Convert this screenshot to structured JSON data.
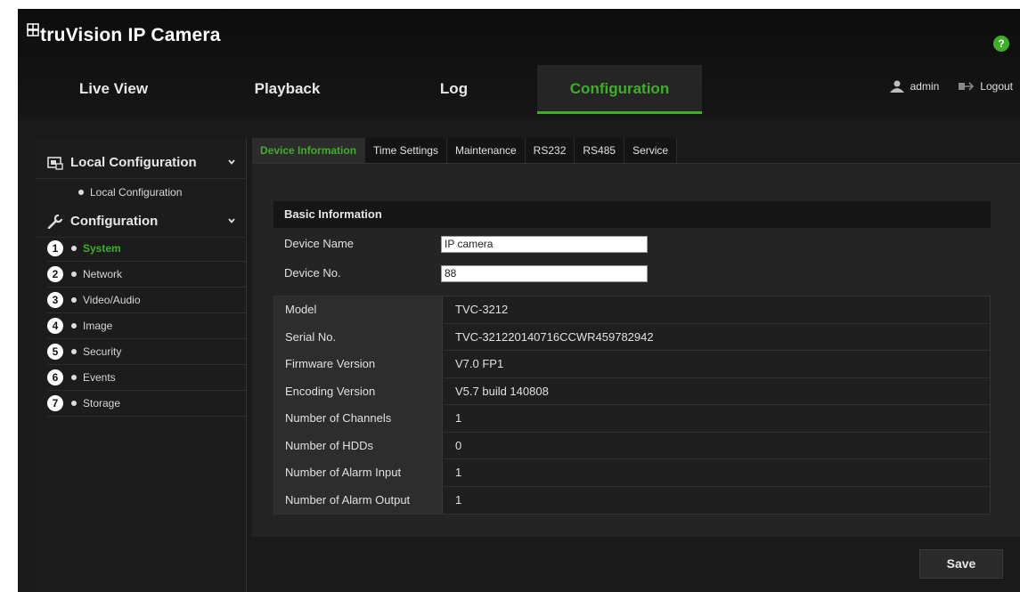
{
  "app": {
    "brand": "truVision IP Camera",
    "help": "?"
  },
  "nav": {
    "tabs": [
      "Live View",
      "Playback",
      "Log",
      "Configuration"
    ],
    "active": "Configuration"
  },
  "user": {
    "name": "admin",
    "logout": "Logout"
  },
  "sidebar": {
    "local_group": "Local Configuration",
    "local_item": "Local Configuration",
    "config_group": "Configuration",
    "items": [
      {
        "num": "1",
        "label": "System"
      },
      {
        "num": "2",
        "label": "Network"
      },
      {
        "num": "3",
        "label": "Video/Audio"
      },
      {
        "num": "4",
        "label": "Image"
      },
      {
        "num": "5",
        "label": "Security"
      },
      {
        "num": "6",
        "label": "Events"
      },
      {
        "num": "7",
        "label": "Storage"
      }
    ]
  },
  "subtabs": [
    "Device Information",
    "Time Settings",
    "Maintenance",
    "RS232",
    "RS485",
    "Service"
  ],
  "basic": {
    "title": "Basic Information",
    "device_name_label": "Device Name",
    "device_name_value": "IP camera",
    "device_no_label": "Device No.",
    "device_no_value": "88"
  },
  "info": [
    {
      "key": "Model",
      "value": "TVC-3212"
    },
    {
      "key": "Serial No.",
      "value": "TVC-321220140716CCWR459782942"
    },
    {
      "key": "Firmware Version",
      "value": "V7.0 FP1"
    },
    {
      "key": "Encoding Version",
      "value": "V5.7 build 140808"
    },
    {
      "key": "Number of Channels",
      "value": "1"
    },
    {
      "key": "Number of HDDs",
      "value": "0"
    },
    {
      "key": "Number of Alarm Input",
      "value": "1"
    },
    {
      "key": "Number of Alarm Output",
      "value": "1"
    }
  ],
  "save_label": "Save",
  "colors": {
    "accent": "#3fae29",
    "background": "#1a1a1a"
  }
}
